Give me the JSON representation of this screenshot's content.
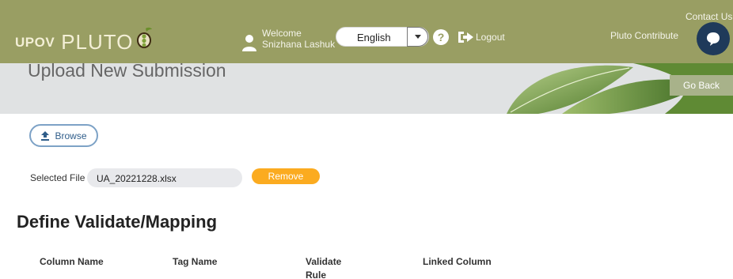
{
  "header": {
    "logo_upov": "UPOV",
    "logo_pluto": "PLUTO",
    "welcome_label": "Welcome",
    "user_name": "Snizhana Lashuk",
    "language": "English",
    "logout_label": "Logout",
    "contact_us_label": "Contact Us",
    "contribute_label": "Pluto Contribute",
    "colors": {
      "bar": "#999e63",
      "chat": "#1f3a5a"
    }
  },
  "banner": {
    "title": "Upload New Submission",
    "go_back_label": "Go Back"
  },
  "upload": {
    "browse_label": "Browse",
    "selected_file_label": "Selected File",
    "file_name": "UA_20221228.xlsx",
    "remove_label": "Remove"
  },
  "mapping": {
    "title": "Define Validate/Mapping",
    "columns": [
      {
        "line1": "Column Name",
        "line2": ""
      },
      {
        "line1": "Tag Name",
        "line2": ""
      },
      {
        "line1": "Validate",
        "line2": "Rule"
      },
      {
        "line1": "Linked Column",
        "line2": ""
      }
    ]
  },
  "icons": [
    "pea-pod-logo",
    "user-icon",
    "chevron-down-icon",
    "help-icon",
    "logout-icon",
    "chat-icon",
    "upload-icon"
  ]
}
